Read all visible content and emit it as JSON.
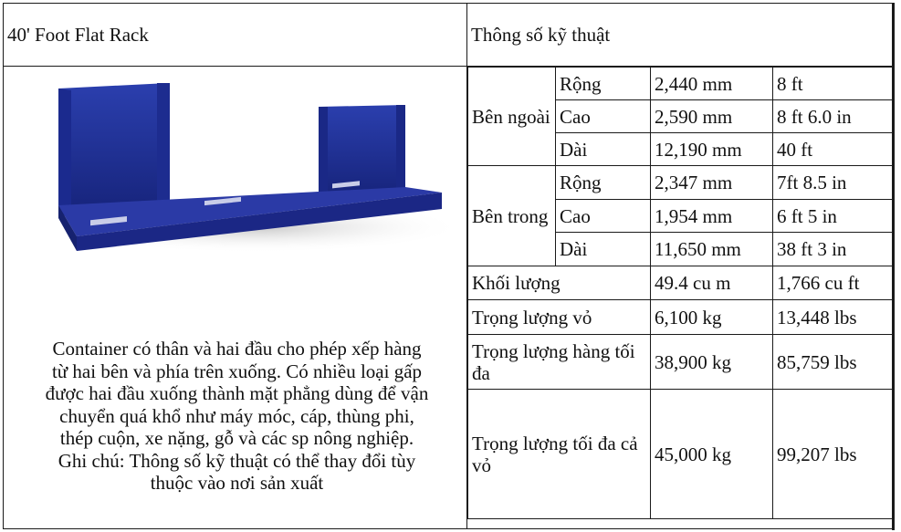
{
  "header": {
    "product_title": "40' Foot Flat Rack",
    "spec_title": "Thông số kỹ thuật"
  },
  "image": {
    "description_alt": "Blue 40 foot flat rack container"
  },
  "description_lines": [
    "Container có thân và hai đầu cho phép xếp hàng",
    "từ hai bên và phía trên xuống. Có nhiều loại gấp",
    "được hai đầu xuống thành mặt phẳng dùng để vận",
    "chuyển  quá khổ như máy móc, cáp, thùng phi,",
    "thép cuộn, xe nặng, gỗ và các sp nông nghiệp.",
    "Ghi chú: Thông số kỹ thuật có thể thay đổi tùy",
    "thuộc vào nơi sản xuất"
  ],
  "spec": {
    "outside": {
      "label": "Bên ngoài",
      "rows": [
        {
          "name": "Rộng",
          "metric": "2,440 mm",
          "imperial": "8 ft"
        },
        {
          "name": "Cao",
          "metric": "2,590 mm",
          "imperial": "8 ft 6.0 in"
        },
        {
          "name": "Dài",
          "metric": "12,190 mm",
          "imperial": "40 ft"
        }
      ]
    },
    "inside": {
      "label": "Bên trong",
      "rows": [
        {
          "name": "Rộng",
          "metric": "2,347 mm",
          "imperial": "7ft 8.5 in"
        },
        {
          "name": "Cao",
          "metric": "1,954 mm",
          "imperial": "6 ft 5 in"
        },
        {
          "name": "Dài",
          "metric": "11,650 mm",
          "imperial": "38 ft 3 in"
        }
      ]
    },
    "volume": {
      "name": "Khối lượng",
      "metric": "49.4 cu m",
      "imperial": "1,766 cu ft"
    },
    "tare": {
      "name": "Trọng lượng vỏ",
      "metric": "6,100 kg",
      "imperial": "13,448 lbs"
    },
    "max_payload": {
      "name": "Trọng lượng hàng tối đa",
      "metric": "38,900 kg",
      "imperial": "85,759 lbs"
    },
    "max_gross": {
      "name": "Trọng lượng tối đa cả vỏ",
      "metric": "45,000 kg",
      "imperial": "99,207 lbs"
    }
  }
}
